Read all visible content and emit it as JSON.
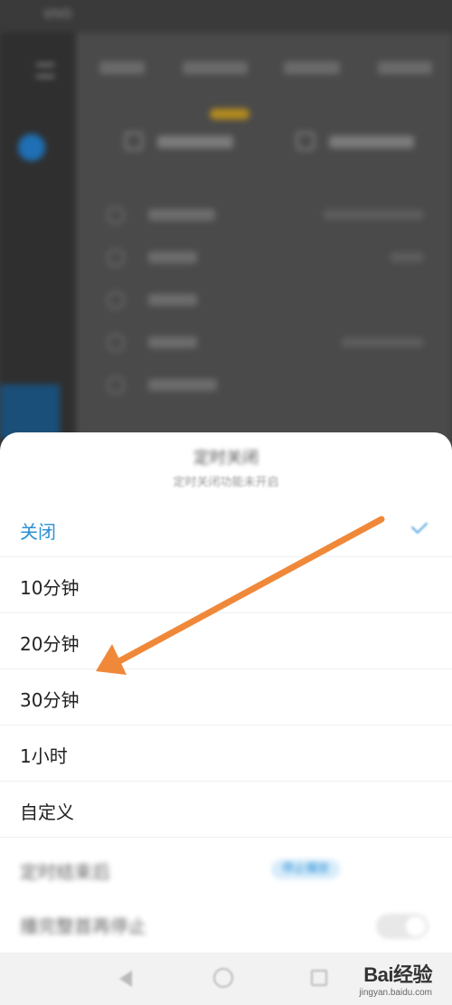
{
  "status_bar": {
    "left": "VIVO",
    "right": ""
  },
  "sheet": {
    "title": "定时关闭",
    "subtitle": "定时关闭功能未开启",
    "options": [
      {
        "label": "关闭",
        "selected": true
      },
      {
        "label": "10分钟",
        "selected": false
      },
      {
        "label": "20分钟",
        "selected": false
      },
      {
        "label": "30分钟",
        "selected": false
      },
      {
        "label": "1小时",
        "selected": false
      },
      {
        "label": "自定义",
        "selected": false
      }
    ],
    "after_end": {
      "label": "定时结束后",
      "option_a": "停止播放",
      "option_b": ""
    },
    "extra_toggle": {
      "label": "播完整首再停止",
      "on": false
    }
  },
  "watermark": {
    "brand": "Bai经验",
    "url": "jingyan.baidu.com"
  },
  "colors": {
    "accent": "#2a90d6",
    "arrow": "#f0883a"
  }
}
